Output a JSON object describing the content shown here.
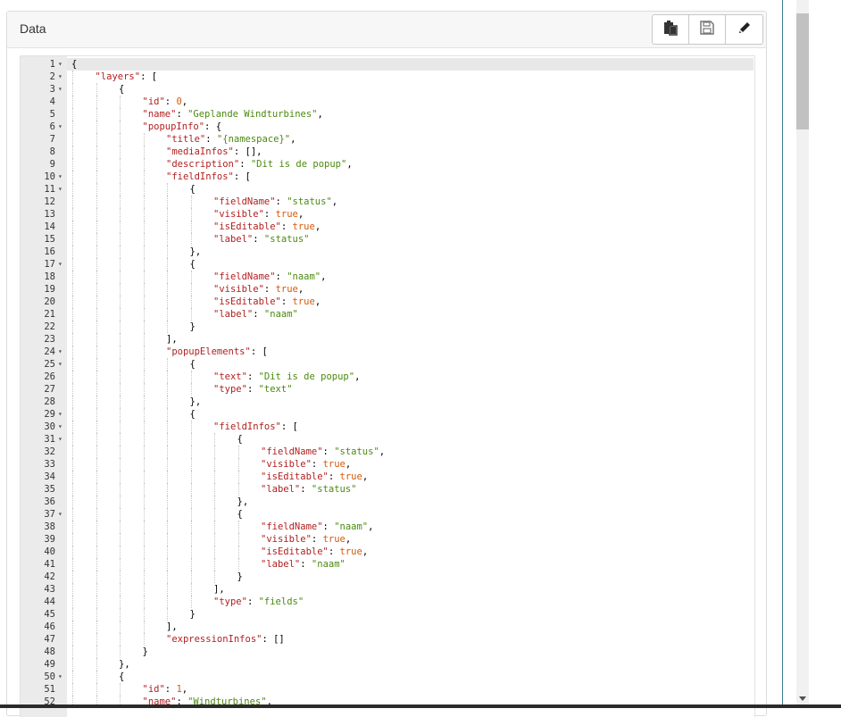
{
  "panel": {
    "title": "Data",
    "buttons": [
      {
        "name": "paste",
        "icon": "clipboard-icon"
      },
      {
        "name": "save",
        "icon": "floppy-disk-icon"
      },
      {
        "name": "edit",
        "icon": "pencil-icon"
      }
    ]
  },
  "editor": {
    "lines": [
      {
        "n": "1",
        "fold": true,
        "depth": 0,
        "code": "{"
      },
      {
        "n": "2",
        "fold": true,
        "depth": 1,
        "code": "\"layers\": ["
      },
      {
        "n": "3",
        "fold": true,
        "depth": 2,
        "code": "{"
      },
      {
        "n": "4",
        "fold": false,
        "depth": 3,
        "code": "\"id\": 0,"
      },
      {
        "n": "5",
        "fold": false,
        "depth": 3,
        "code": "\"name\": \"Geplande Windturbines\","
      },
      {
        "n": "6",
        "fold": true,
        "depth": 3,
        "code": "\"popupInfo\": {"
      },
      {
        "n": "7",
        "fold": false,
        "depth": 4,
        "code": "\"title\": \"{namespace}\","
      },
      {
        "n": "8",
        "fold": false,
        "depth": 4,
        "code": "\"mediaInfos\": [],"
      },
      {
        "n": "9",
        "fold": false,
        "depth": 4,
        "code": "\"description\": \"Dit is de popup\","
      },
      {
        "n": "10",
        "fold": true,
        "depth": 4,
        "code": "\"fieldInfos\": ["
      },
      {
        "n": "11",
        "fold": true,
        "depth": 5,
        "code": "{"
      },
      {
        "n": "12",
        "fold": false,
        "depth": 6,
        "code": "\"fieldName\": \"status\","
      },
      {
        "n": "13",
        "fold": false,
        "depth": 6,
        "code": "\"visible\": true,"
      },
      {
        "n": "14",
        "fold": false,
        "depth": 6,
        "code": "\"isEditable\": true,"
      },
      {
        "n": "15",
        "fold": false,
        "depth": 6,
        "code": "\"label\": \"status\""
      },
      {
        "n": "16",
        "fold": false,
        "depth": 5,
        "code": "},"
      },
      {
        "n": "17",
        "fold": true,
        "depth": 5,
        "code": "{"
      },
      {
        "n": "18",
        "fold": false,
        "depth": 6,
        "code": "\"fieldName\": \"naam\","
      },
      {
        "n": "19",
        "fold": false,
        "depth": 6,
        "code": "\"visible\": true,"
      },
      {
        "n": "20",
        "fold": false,
        "depth": 6,
        "code": "\"isEditable\": true,"
      },
      {
        "n": "21",
        "fold": false,
        "depth": 6,
        "code": "\"label\": \"naam\""
      },
      {
        "n": "22",
        "fold": false,
        "depth": 5,
        "code": "}"
      },
      {
        "n": "23",
        "fold": false,
        "depth": 4,
        "code": "],"
      },
      {
        "n": "24",
        "fold": true,
        "depth": 4,
        "code": "\"popupElements\": ["
      },
      {
        "n": "25",
        "fold": true,
        "depth": 5,
        "code": "{"
      },
      {
        "n": "26",
        "fold": false,
        "depth": 6,
        "code": "\"text\": \"Dit is de popup\","
      },
      {
        "n": "27",
        "fold": false,
        "depth": 6,
        "code": "\"type\": \"text\""
      },
      {
        "n": "28",
        "fold": false,
        "depth": 5,
        "code": "},"
      },
      {
        "n": "29",
        "fold": true,
        "depth": 5,
        "code": "{"
      },
      {
        "n": "30",
        "fold": true,
        "depth": 6,
        "code": "\"fieldInfos\": ["
      },
      {
        "n": "31",
        "fold": true,
        "depth": 7,
        "code": "{"
      },
      {
        "n": "32",
        "fold": false,
        "depth": 8,
        "code": "\"fieldName\": \"status\","
      },
      {
        "n": "33",
        "fold": false,
        "depth": 8,
        "code": "\"visible\": true,"
      },
      {
        "n": "34",
        "fold": false,
        "depth": 8,
        "code": "\"isEditable\": true,"
      },
      {
        "n": "35",
        "fold": false,
        "depth": 8,
        "code": "\"label\": \"status\""
      },
      {
        "n": "36",
        "fold": false,
        "depth": 7,
        "code": "},"
      },
      {
        "n": "37",
        "fold": true,
        "depth": 7,
        "code": "{"
      },
      {
        "n": "38",
        "fold": false,
        "depth": 8,
        "code": "\"fieldName\": \"naam\","
      },
      {
        "n": "39",
        "fold": false,
        "depth": 8,
        "code": "\"visible\": true,"
      },
      {
        "n": "40",
        "fold": false,
        "depth": 8,
        "code": "\"isEditable\": true,"
      },
      {
        "n": "41",
        "fold": false,
        "depth": 8,
        "code": "\"label\": \"naam\""
      },
      {
        "n": "42",
        "fold": false,
        "depth": 7,
        "code": "}"
      },
      {
        "n": "43",
        "fold": false,
        "depth": 6,
        "code": "],"
      },
      {
        "n": "44",
        "fold": false,
        "depth": 6,
        "code": "\"type\": \"fields\""
      },
      {
        "n": "45",
        "fold": false,
        "depth": 5,
        "code": "}"
      },
      {
        "n": "46",
        "fold": false,
        "depth": 4,
        "code": "],"
      },
      {
        "n": "47",
        "fold": false,
        "depth": 4,
        "code": "\"expressionInfos\": []"
      },
      {
        "n": "48",
        "fold": false,
        "depth": 3,
        "code": "}"
      },
      {
        "n": "49",
        "fold": false,
        "depth": 2,
        "code": "},"
      },
      {
        "n": "50",
        "fold": true,
        "depth": 2,
        "code": "{"
      },
      {
        "n": "51",
        "fold": false,
        "depth": 3,
        "code": "\"id\": 1,"
      },
      {
        "n": "52",
        "fold": false,
        "depth": 3,
        "code": "\"name\": \"Windturbines\","
      }
    ]
  },
  "colors": {
    "key": "#b22020",
    "string": "#4b8a0f",
    "number": "#d6590b",
    "boolean": "#d6590b"
  }
}
